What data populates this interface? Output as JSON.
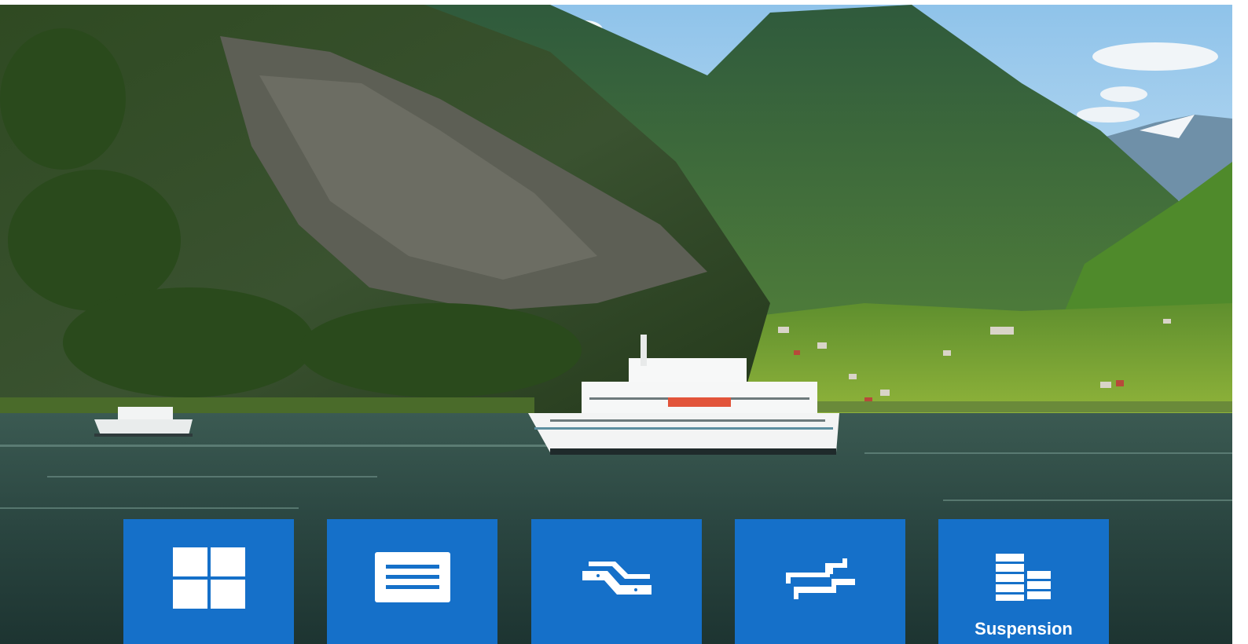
{
  "tiles": [
    {
      "icon": "grid-four-panels-icon",
      "label": ""
    },
    {
      "icon": "lines-panel-icon",
      "label": ""
    },
    {
      "icon": "connector-rails-icon",
      "label": ""
    },
    {
      "icon": "stepped-rails-icon",
      "label": ""
    },
    {
      "icon": "suspension-blocks-icon",
      "label": "Suspension"
    }
  ],
  "colors": {
    "tile": "#1570c9",
    "icon": "#ffffff"
  }
}
